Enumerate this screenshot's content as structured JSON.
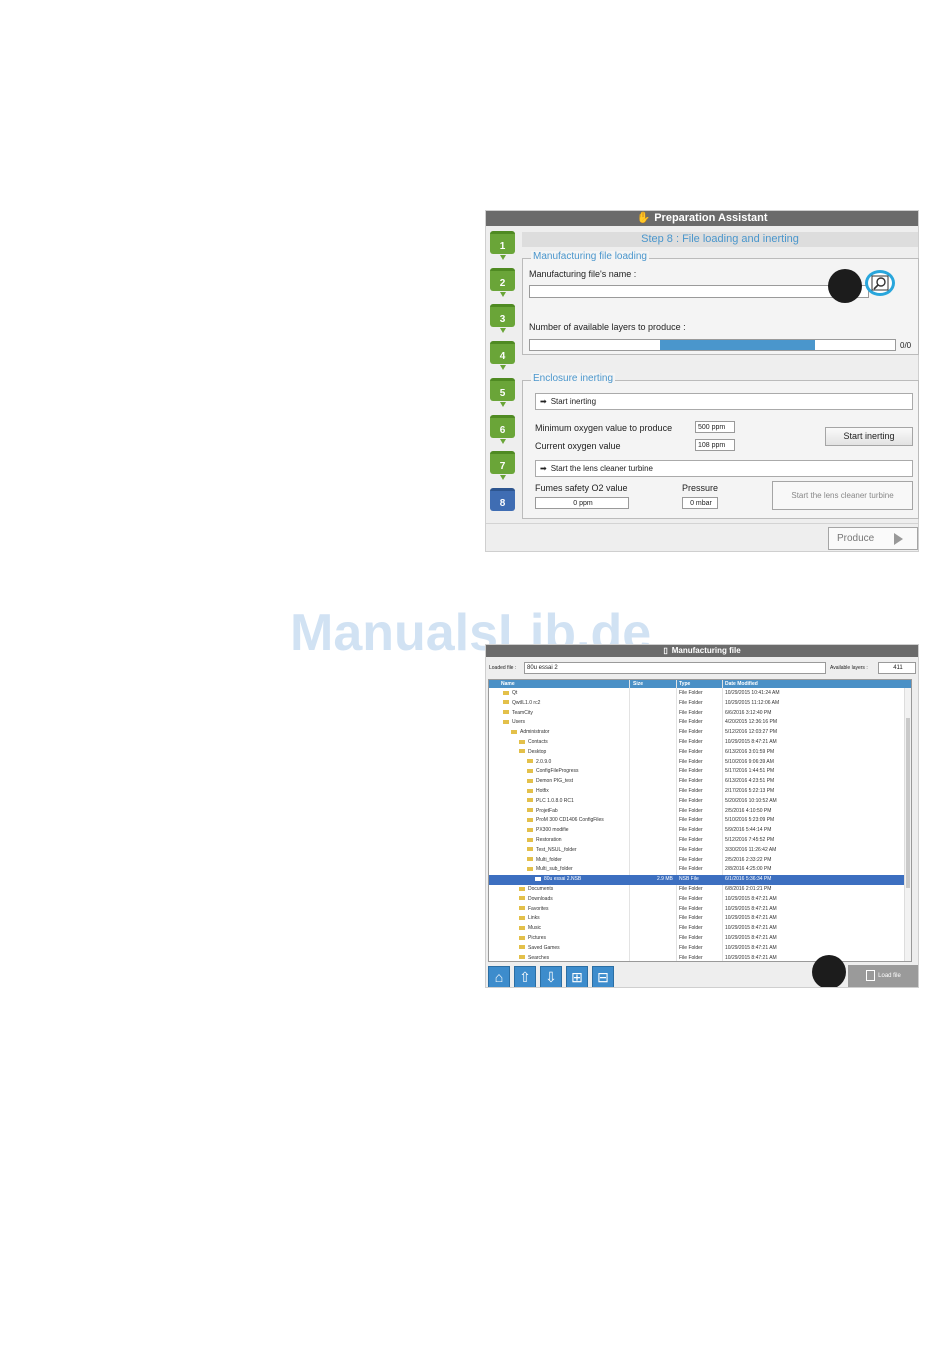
{
  "prep": {
    "title": "Preparation Assistant",
    "title_icon": "hand-icon",
    "steps": [
      "1",
      "2",
      "3",
      "4",
      "5",
      "6",
      "7",
      "8"
    ],
    "current_step": "8",
    "step_title": "Step 8 : File loading and inerting",
    "file_group": {
      "legend": "Manufacturing file loading",
      "file_name_label": "Manufacturing file's name :",
      "file_name_value": "",
      "layers_label": "Number of available layers to produce :",
      "layers_count": "0/0",
      "browse_icon": "magnifier-icon"
    },
    "inerting_group": {
      "legend": "Enclosure inerting",
      "start_inerting_header": "Start inerting",
      "min_oxygen_label": "Minimum oxygen value to produce",
      "min_oxygen_value": "500 ppm",
      "current_oxygen_label": "Current oxygen value",
      "current_oxygen_value": "108 ppm",
      "start_inerting_button": "Start inerting",
      "lens_header": "Start the lens cleaner turbine",
      "fumes_label": "Fumes safety O2 value",
      "fumes_value": "0 ppm",
      "pressure_label": "Pressure",
      "pressure_value": "0 mbar",
      "lens_button": "Start the lens cleaner turbine"
    },
    "produce_button": "Produce",
    "accent_color": "#4a96cc",
    "step_done_color": "#6aa538",
    "step_current_color": "#3f6db3"
  },
  "watermark": "ManualsLib.de",
  "mfile": {
    "title": "Manufacturing file",
    "loaded_file_label": "Loaded file :",
    "loaded_file_value": "80u essai 2",
    "available_layers_label": "Available layers :",
    "available_layers_value": "411",
    "columns": [
      "Name",
      "Size",
      "Type",
      "Date Modified"
    ],
    "rows": [
      {
        "name": "Qt",
        "size": "",
        "type": "File Folder",
        "date": "10/29/2015 10:41:24 AM",
        "indent": 1
      },
      {
        "name": "QwtIL1.0 rc2",
        "size": "",
        "type": "File Folder",
        "date": "10/29/2015 11:12:06 AM",
        "indent": 1
      },
      {
        "name": "TeamCity",
        "size": "",
        "type": "File Folder",
        "date": "6/6/2016 3:12:40 PM",
        "indent": 1
      },
      {
        "name": "Users",
        "size": "",
        "type": "File Folder",
        "date": "4/20/2015 12:36:16 PM",
        "indent": 1
      },
      {
        "name": "Administrator",
        "size": "",
        "type": "File Folder",
        "date": "5/12/2016 12:03:27 PM",
        "indent": 2
      },
      {
        "name": "Contacts",
        "size": "",
        "type": "File Folder",
        "date": "10/29/2015 8:47:21 AM",
        "indent": 3
      },
      {
        "name": "Desktop",
        "size": "",
        "type": "File Folder",
        "date": "6/13/2016 3:01:59 PM",
        "indent": 3
      },
      {
        "name": "2.0.9.0",
        "size": "",
        "type": "File Folder",
        "date": "5/10/2016 9:06:39 AM",
        "indent": 4
      },
      {
        "name": "ConfigFileProgress",
        "size": "",
        "type": "File Folder",
        "date": "5/17/2016 1:44:51 PM",
        "indent": 4
      },
      {
        "name": "Demon PIG_test",
        "size": "",
        "type": "File Folder",
        "date": "6/13/2016 4:23:51 PM",
        "indent": 4
      },
      {
        "name": "Hotfix",
        "size": "",
        "type": "File Folder",
        "date": "2/17/2016 5:22:13 PM",
        "indent": 4
      },
      {
        "name": "PLC 1.0.8.0 RC1",
        "size": "",
        "type": "File Folder",
        "date": "5/20/2016 10:10:52 AM",
        "indent": 4
      },
      {
        "name": "ProjetFab",
        "size": "",
        "type": "File Folder",
        "date": "2/5/2016 4:10:50 PM",
        "indent": 4
      },
      {
        "name": "ProM 300 CD1406 ConfigFiles",
        "size": "",
        "type": "File Folder",
        "date": "5/10/2016 5:23:09 PM",
        "indent": 4
      },
      {
        "name": "PX300 modifie",
        "size": "",
        "type": "File Folder",
        "date": "5/9/2016 5:44:14 PM",
        "indent": 4
      },
      {
        "name": "Restoration",
        "size": "",
        "type": "File Folder",
        "date": "5/12/2016 7:45:52 PM",
        "indent": 4
      },
      {
        "name": "Test_NSUL_folder",
        "size": "",
        "type": "File Folder",
        "date": "3/30/2016 11:26:42 AM",
        "indent": 4
      },
      {
        "name": "Multi_folder",
        "size": "",
        "type": "File Folder",
        "date": "2/5/2016 2:33:22 PM",
        "indent": 4
      },
      {
        "name": "Multi_sub_folder",
        "size": "",
        "type": "File Folder",
        "date": "2/8/2016 4:25:00 PM",
        "indent": 4
      },
      {
        "name": "80u essai 2.NSB",
        "size": "2.9 MB",
        "type": "NSB File",
        "date": "6/1/2016 5:36:34 PM",
        "indent": 5,
        "selected": true
      },
      {
        "name": "Documents",
        "size": "",
        "type": "File Folder",
        "date": "6/8/2016 2:01:21 PM",
        "indent": 3
      },
      {
        "name": "Downloads",
        "size": "",
        "type": "File Folder",
        "date": "10/29/2015 8:47:21 AM",
        "indent": 3
      },
      {
        "name": "Favorites",
        "size": "",
        "type": "File Folder",
        "date": "10/29/2015 8:47:21 AM",
        "indent": 3
      },
      {
        "name": "Links",
        "size": "",
        "type": "File Folder",
        "date": "10/29/2015 8:47:21 AM",
        "indent": 3
      },
      {
        "name": "Music",
        "size": "",
        "type": "File Folder",
        "date": "10/29/2015 8:47:21 AM",
        "indent": 3
      },
      {
        "name": "Pictures",
        "size": "",
        "type": "File Folder",
        "date": "10/29/2015 8:47:21 AM",
        "indent": 3
      },
      {
        "name": "Saved Games",
        "size": "",
        "type": "File Folder",
        "date": "10/29/2015 8:47:21 AM",
        "indent": 3
      },
      {
        "name": "Searches",
        "size": "",
        "type": "File Folder",
        "date": "10/29/2015 8:47:21 AM",
        "indent": 3
      }
    ],
    "toolbar_icons": [
      "home-drive-icon",
      "upload-icon",
      "download-icon",
      "expand-all-icon",
      "collapse-all-icon"
    ],
    "toolbar_glyphs": [
      "⌂",
      "⇧",
      "⇩",
      "⊞",
      "⊟"
    ],
    "load_button": "Load file",
    "header_color": "#4a90c6"
  }
}
